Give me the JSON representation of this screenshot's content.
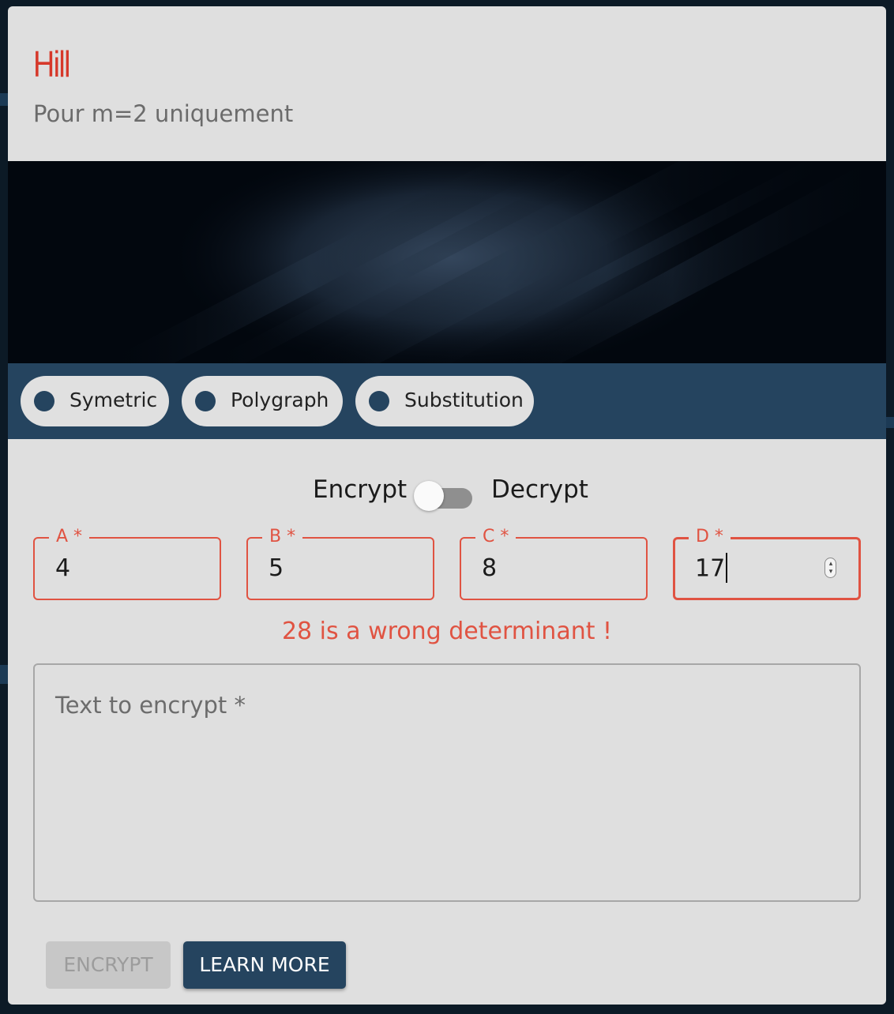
{
  "header": {
    "title": "Hill",
    "subtitle": "Pour m=2 uniquement"
  },
  "categories": [
    {
      "label": "Symetric"
    },
    {
      "label": "Polygraph"
    },
    {
      "label": "Substitution"
    }
  ],
  "mode_toggle": {
    "left_label": "Encrypt",
    "right_label": "Decrypt",
    "checked": false
  },
  "matrix_fields": [
    {
      "label": "A *",
      "value": "4"
    },
    {
      "label": "B *",
      "value": "5"
    },
    {
      "label": "C *",
      "value": "8"
    },
    {
      "label": "D *",
      "value": "17"
    }
  ],
  "error_message": "28 is a wrong determinant !",
  "text_input": {
    "placeholder": "Text to encrypt *",
    "value": ""
  },
  "buttons": {
    "encrypt_label": "ENCRYPT",
    "learn_more_label": "LEARN MORE"
  },
  "colors": {
    "accent": "#d6382a",
    "error": "#e05342",
    "primary": "#25445f",
    "card_background": "#dfdfdf",
    "page_background": "#0c1a26"
  }
}
